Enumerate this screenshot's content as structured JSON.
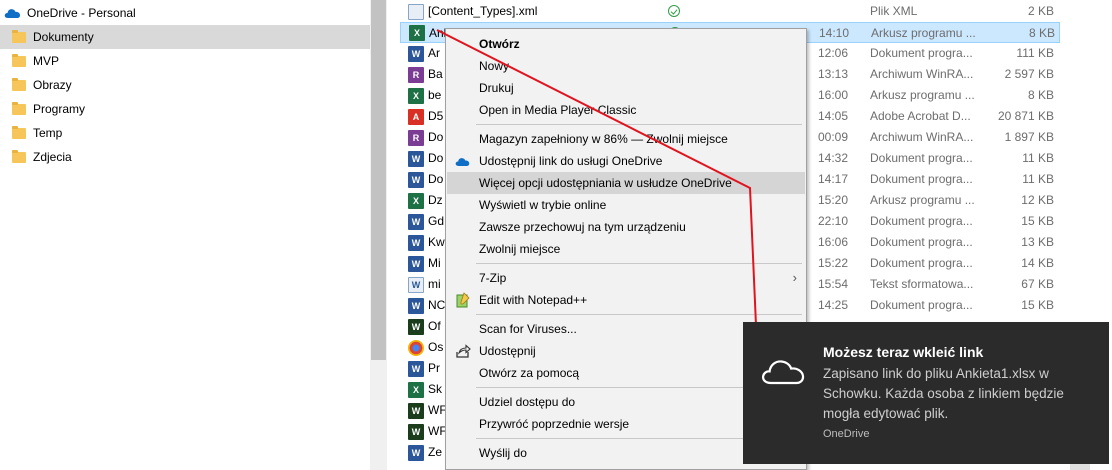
{
  "nav": {
    "root_label": "OneDrive - Personal",
    "items": [
      {
        "label": "Dokumenty",
        "selected": true
      },
      {
        "label": "MVP"
      },
      {
        "label": "Obrazy"
      },
      {
        "label": "Programy"
      },
      {
        "label": "Temp"
      },
      {
        "label": "Zdjecia"
      }
    ]
  },
  "files": [
    {
      "name": "[Content_Types].xml",
      "icon": "xml-file-icon",
      "time": "",
      "type": "Plik XML",
      "size": "2 KB",
      "synced": true
    },
    {
      "name": "Ankieta1.xlsx",
      "icon": "excel-file-icon",
      "time": "14:10",
      "type": "Arkusz programu ...",
      "size": "8 KB",
      "synced": true,
      "selected": true
    },
    {
      "name": "Ar",
      "icon": "word-file-icon",
      "time": "12:06",
      "type": "Dokument progra...",
      "size": "111 KB"
    },
    {
      "name": "Ba",
      "icon": "winrar-file-icon",
      "time": "13:13",
      "type": "Archiwum WinRA...",
      "size": "2 597 KB"
    },
    {
      "name": "be",
      "icon": "excel-file-icon",
      "time": "16:00",
      "type": "Arkusz programu ...",
      "size": "8 KB"
    },
    {
      "name": "D5",
      "icon": "pdf-file-icon",
      "time": "14:05",
      "type": "Adobe Acrobat D...",
      "size": "20 871 KB"
    },
    {
      "name": "Do",
      "icon": "winrar-file-icon",
      "time": "00:09",
      "type": "Archiwum WinRA...",
      "size": "1 897 KB"
    },
    {
      "name": "Do",
      "icon": "word-file-icon",
      "time": "14:32",
      "type": "Dokument progra...",
      "size": "11 KB"
    },
    {
      "name": "Do",
      "icon": "word-file-icon",
      "time": "14:17",
      "type": "Dokument progra...",
      "size": "11 KB"
    },
    {
      "name": "Dz",
      "icon": "excel-file-icon",
      "time": "15:20",
      "type": "Arkusz programu ...",
      "size": "12 KB"
    },
    {
      "name": "Gd",
      "icon": "word-file-icon",
      "time": "22:10",
      "type": "Dokument progra...",
      "size": "15 KB"
    },
    {
      "name": "Kw",
      "icon": "word-file-icon",
      "time": "16:06",
      "type": "Dokument progra...",
      "size": "13 KB"
    },
    {
      "name": "Mi",
      "icon": "word-file-icon",
      "time": "15:22",
      "type": "Dokument progra...",
      "size": "14 KB"
    },
    {
      "name": "mi",
      "icon": "text-file-icon",
      "time": "15:54",
      "type": "Tekst sformatowa...",
      "size": "67 KB"
    },
    {
      "name": "NC",
      "icon": "word-file-icon",
      "time": "14:25",
      "type": "Dokument progra...",
      "size": "15 KB"
    },
    {
      "name": "Of",
      "icon": "exe-file-icon",
      "time": "",
      "type": "",
      "size": ""
    },
    {
      "name": "Os",
      "icon": "chrome-file-icon",
      "time": "",
      "type": "",
      "size": ""
    },
    {
      "name": "Pr",
      "icon": "word-file-icon",
      "time": "",
      "type": "",
      "size": ""
    },
    {
      "name": "Sk",
      "icon": "excel-file-icon",
      "time": "",
      "type": "",
      "size": ""
    },
    {
      "name": "WF",
      "icon": "exe-file-icon",
      "time": "",
      "type": "",
      "size": ""
    },
    {
      "name": "WF",
      "icon": "exe-file-icon",
      "time": "",
      "type": "",
      "size": ""
    },
    {
      "name": "Ze",
      "icon": "word-file-icon",
      "time": "",
      "type": "",
      "size": ""
    }
  ],
  "context_menu": {
    "items": [
      {
        "label": "Otwórz",
        "bold": true
      },
      {
        "label": "Nowy"
      },
      {
        "label": "Drukuj"
      },
      {
        "label": "Open in Media Player Classic"
      },
      {
        "label": "Magazyn zapełniony w 86% — Zwolnij miejsce"
      },
      {
        "label": "Udostępnij link do usługi OneDrive",
        "icon": "onedrive-cloud-icon"
      },
      {
        "label": "Więcej opcji udostępniania w usłudze OneDrive",
        "hover": true
      },
      {
        "label": "Wyświetl w trybie online"
      },
      {
        "label": "Zawsze przechowuj na tym urządzeniu"
      },
      {
        "label": "Zwolnij miejsce"
      },
      {
        "label": "7-Zip",
        "submenu": true
      },
      {
        "label": "Edit with Notepad++",
        "icon": "notepadpp-icon"
      },
      {
        "label": "Scan for Viruses..."
      },
      {
        "label": "Udostępnij",
        "icon": "share-icon"
      },
      {
        "label": "Otwórz za pomocą"
      },
      {
        "label": "Udziel dostępu do"
      },
      {
        "label": "Przywróć poprzednie wersje"
      },
      {
        "label": "Wyślij do"
      }
    ]
  },
  "toast": {
    "title": "Możesz teraz wkleić link",
    "body": "Zapisano link do pliku Ankieta1.xlsx w Schowku. Każda osoba z linkiem będzie mogła edytować plik.",
    "source": "OneDrive"
  },
  "colors": {
    "selection": "#cce8ff",
    "nav_selected": "#d9d9d9",
    "annotation_line": "#e0141e",
    "toast_bg": "#2b2b2b",
    "onedrive_blue": "#0f6fc6"
  }
}
